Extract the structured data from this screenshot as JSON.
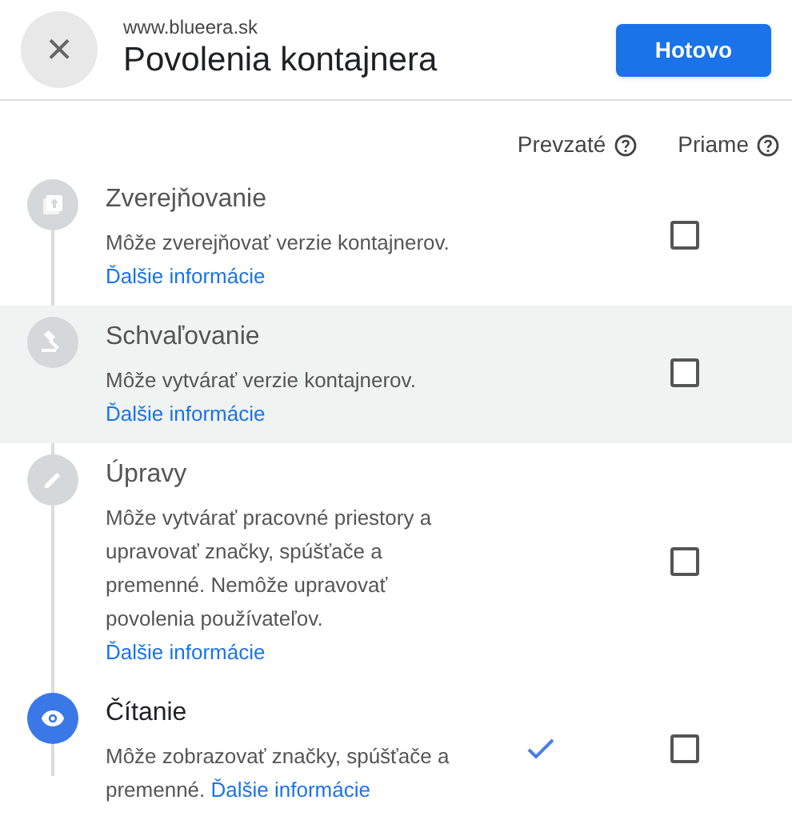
{
  "header": {
    "close_label": "×",
    "site": "www.blueera.sk",
    "title": "Povolenia kontajnera",
    "done_button": "Hotovo"
  },
  "columns": [
    {
      "label": "Prevzaté"
    },
    {
      "label": "Priame"
    }
  ],
  "roles": [
    {
      "kind": "publish",
      "title": "Zverejňovanie",
      "description": "Môže zverejňovať verzie kontajnerov.",
      "link": "Ďalšie informácie",
      "inherited": false,
      "checked": false,
      "highlighted": false,
      "active": false
    },
    {
      "kind": "approve",
      "title": "Schvaľovanie",
      "description": "Môže vytvárať verzie kontajnerov.",
      "link": "Ďalšie informácie",
      "inherited": false,
      "checked": false,
      "highlighted": true,
      "active": false
    },
    {
      "kind": "edit",
      "title": "Úpravy",
      "description": "Môže vytvárať pracovné priestory a upravovať značky, spúšťače a premenné. Nemôže upravovať povolenia používateľov.",
      "link": "Ďalšie informácie",
      "inherited": false,
      "checked": false,
      "highlighted": false,
      "active": false
    },
    {
      "kind": "read",
      "title": "Čítanie",
      "description": "Môže zobrazovať značky, spúšťače a premenné.",
      "link": "Ďalšie informácie",
      "inherited": true,
      "checked": false,
      "highlighted": false,
      "active": true
    }
  ]
}
